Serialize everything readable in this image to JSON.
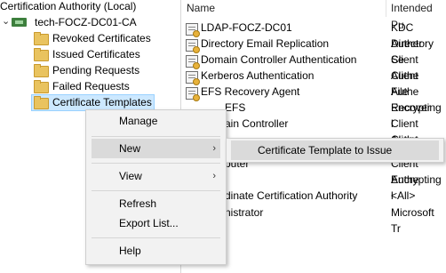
{
  "tree": {
    "root_label": "Certification Authority (Local)",
    "ca_label": "tech-FOCZ-DC01-CA",
    "items": [
      {
        "label": "Revoked Certificates"
      },
      {
        "label": "Issued Certificates"
      },
      {
        "label": "Pending Requests"
      },
      {
        "label": "Failed Requests"
      },
      {
        "label": "Certificate Templates"
      }
    ]
  },
  "list": {
    "headers": [
      "Name",
      "Intended Pu"
    ],
    "rows": [
      {
        "name": "LDAP-FOCZ-DC01",
        "purpose": "KDC Auther"
      },
      {
        "name": "Directory Email Replication",
        "purpose": "Directory Se"
      },
      {
        "name": "Domain Controller Authentication",
        "purpose": "Client Authe"
      },
      {
        "name": "Kerberos Authentication",
        "purpose": "Client Authe"
      },
      {
        "name": "EFS Recovery Agent",
        "purpose": "File Recover"
      },
      {
        "name": "EFS",
        "purpose": "Encrypting l"
      },
      {
        "name": "ain Controller",
        "purpose": "Client Authe"
      },
      {
        "name": "",
        "purpose": "Client Authe"
      },
      {
        "name": "puter",
        "purpose": "Client Authe"
      },
      {
        "name": "",
        "purpose": "Encrypting l"
      },
      {
        "name": "dinate Certification Authority",
        "purpose": "<All>"
      },
      {
        "name": "nistrator",
        "purpose": "Microsoft Tr"
      }
    ]
  },
  "context_menu": {
    "manage": "Manage",
    "new": "New",
    "view": "View",
    "refresh": "Refresh",
    "export": "Export List...",
    "help": "Help",
    "submenu_arrow": "›"
  },
  "submenu": {
    "item": "Certificate Template to Issue"
  },
  "icons": {
    "expand": "expand-chevron-icon",
    "folder": "folder-icon",
    "template": "certificate-template-icon"
  },
  "colors": {
    "selection": "#cce8ff",
    "menu_bg": "#f2f2f2",
    "menu_highlight": "#dadada",
    "folder": "#e9c35f"
  }
}
